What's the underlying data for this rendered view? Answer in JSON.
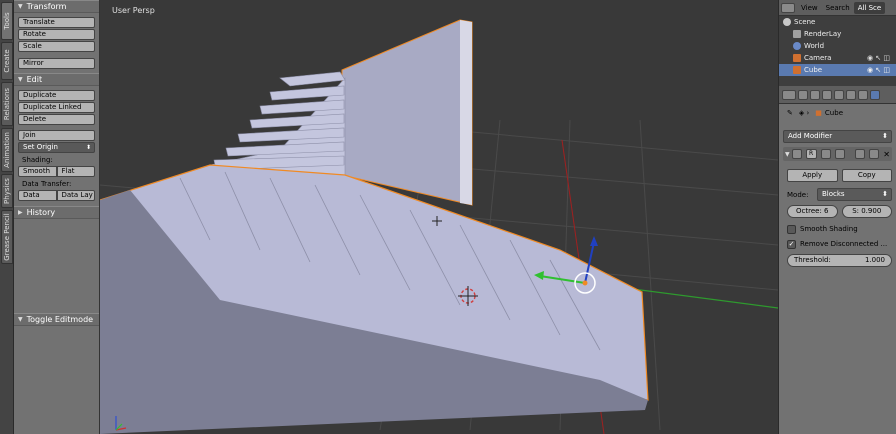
{
  "tabs": [
    "Tools",
    "Create",
    "Relations",
    "Animation",
    "Physics",
    "Grease Pencil"
  ],
  "toolshelf": {
    "transform": {
      "title": "Transform",
      "buttons": [
        "Translate",
        "Rotate",
        "Scale",
        "Mirror"
      ]
    },
    "edit": {
      "title": "Edit",
      "buttons": [
        "Duplicate",
        "Duplicate Linked",
        "Delete",
        "Join"
      ],
      "set_origin": "Set Origin",
      "shading_label": "Shading:",
      "smooth": "Smooth",
      "flat": "Flat",
      "data_transfer_label": "Data Transfer:",
      "data": "Data",
      "data_lay": "Data Lay"
    },
    "history": "History",
    "toggle_editmode": "Toggle Editmode"
  },
  "viewport": {
    "label": "User Persp"
  },
  "outliner": {
    "menu": [
      "View",
      "Search",
      "All Sce"
    ],
    "items": [
      "Scene",
      "RenderLay",
      "World",
      "Camera",
      "Cube"
    ]
  },
  "properties": {
    "object_name": "Cube",
    "add_modifier": "Add Modifier",
    "apply": "Apply",
    "copy": "Copy",
    "mode_label": "Mode:",
    "mode_value": "Blocks",
    "octree": "Octree: 6",
    "scale": "S: 0.900",
    "smooth_shading": "Smooth Shading",
    "remove_disconnected": "Remove Disconnected ...",
    "threshold": "Threshold:",
    "threshold_value": "1.000"
  },
  "colors": {
    "viewport_bg": "#393939",
    "panel_bg": "#727272",
    "selection_orange": "#f08a24",
    "mesh_face": "#b8bad6"
  }
}
